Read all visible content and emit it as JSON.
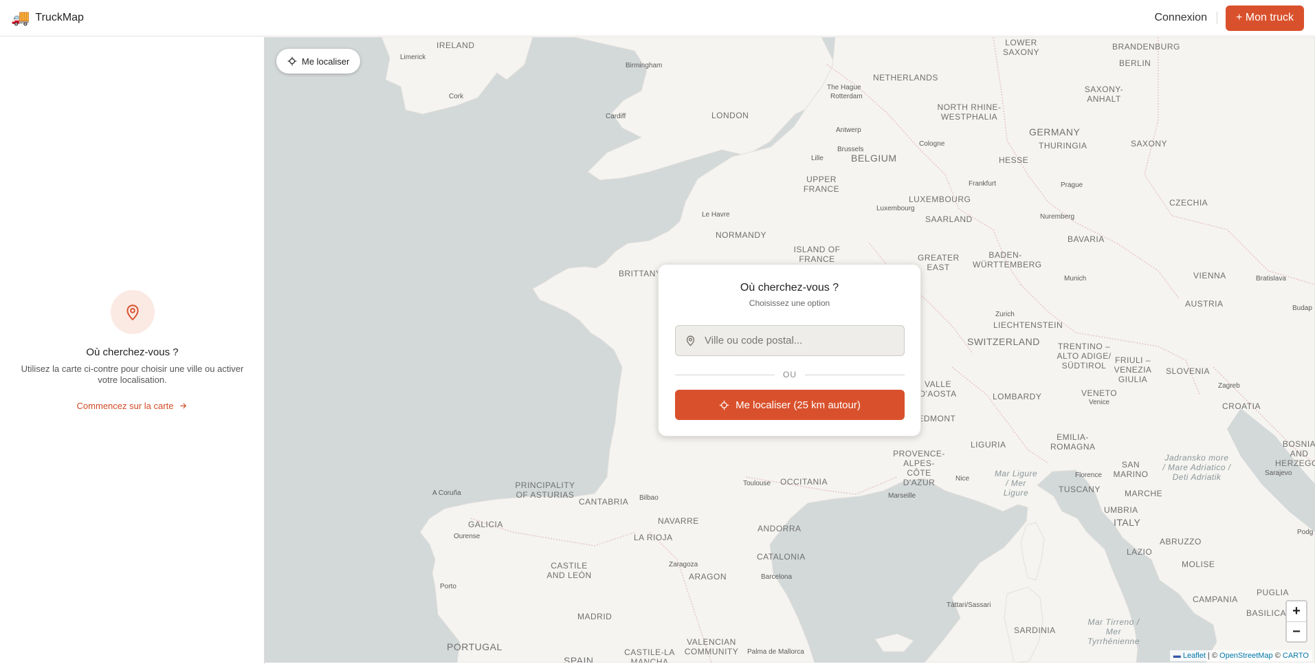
{
  "header": {
    "brand_icon": "🚚",
    "brand_name": "TruckMap",
    "login_label": "Connexion",
    "add_truck_label": "+ Mon truck"
  },
  "sidebar": {
    "empty_title": "Où cherchez-vous ?",
    "empty_text": "Utilisez la carte ci-contre pour choisir une ville ou activer votre localisation.",
    "start_link": "Commencez sur la carte"
  },
  "map": {
    "locate_button": "Me localiser",
    "zoom_in": "+",
    "zoom_out": "−",
    "attribution": {
      "leaflet": "Leaflet",
      "sep1": " | © ",
      "osm": "OpenStreetMap",
      "sep2": " © ",
      "carto": "CARTO"
    },
    "labels": {
      "ireland": "IRELAND",
      "limerick": "Limerick",
      "cork": "Cork",
      "birmingham": "Birmingham",
      "cardiff": "Cardiff",
      "london": "LONDON",
      "lower_saxony": "LOWER SAXONY",
      "brandenburg": "BRANDENBURG",
      "berlin": "BERLIN",
      "netherlands": "NETHERLANDS",
      "the_hague": "The Hague",
      "rotterdam": "Rotterdam",
      "saxony_anhalt": "SAXONY- ANHALT",
      "nrw": "NORTH RHINE- WESTPHALIA",
      "antwerp": "Antwerp",
      "brussels": "Brussels",
      "belgium": "BELGIUM",
      "lille": "Lille",
      "cologne": "Cologne",
      "germany": "GERMANY",
      "thuringia": "THURINGIA",
      "saxony": "SAXONY",
      "hesse": "HESSE",
      "upper_france": "UPPER FRANCE",
      "frankfurt": "Frankfurt",
      "prague": "Prague",
      "czechia": "CZECHIA",
      "luxembourg": "LUXEMBOURG",
      "luxembourg_city": "Luxembourg",
      "le_havre": "Le Havre",
      "nuremberg": "Nuremberg",
      "saarland": "SAARLAND",
      "normandy": "NORMANDY",
      "bavaria": "BAVARIA",
      "island_of_france": "ISLAND OF FRANCE",
      "greater_east": "GREATER EAST",
      "brittany": "BRITTANY",
      "baden": "BADEN- WÜRTTEMBERG",
      "munich": "Munich",
      "vienna": "VIENNA",
      "bratislava": "Bratislava",
      "austria": "AUSTRIA",
      "budapest": "Budap",
      "zurich": "Zurich",
      "liechtenstein": "LIECHTENSTEIN",
      "switzerland": "SWITZERLAND",
      "trentino": "TRENTINO – ALTO ADIGE/ SÜDTIROL",
      "friuli": "FRIULI – VENEZIA GIULIA",
      "slovenia": "SLOVENIA",
      "zagreb": "Zagreb",
      "valle": "VALLE D'AOSTA",
      "lombardy": "LOMBARDY",
      "veneto": "VENETO",
      "venice": "Venice",
      "croatia": "CROATIA",
      "piedmont": "PIEDMONT",
      "liguria": "LIGURIA",
      "emilia": "EMILIA- ROMAGNA",
      "bosnia": "BOSNIA AND HERZEGOVINA",
      "provence": "PROVENCE- ALPES-CÔTE D'AZUR",
      "nice": "Nice",
      "mar_ligure": "Mar Ligure / Mer Ligure",
      "florence": "Florence",
      "san_marino": "SAN MARINO",
      "jadransko": "Jadransko more / Mare Adriatico / Deti Adriatik",
      "sarajevo": "Sarajevo",
      "toulouse": "Toulouse",
      "occitania": "OCCITANIA",
      "marseille": "Marseille",
      "tuscany": "TUSCANY",
      "marche": "MARCHE",
      "a_coruna": "A Coruña",
      "asturias": "PRINCIPALITY OF ASTURIAS",
      "cantabria": "CANTABRIA",
      "bilbao": "Bilbao",
      "galicia": "GALICIA",
      "ourense": "Ourense",
      "navarre": "NAVARRE",
      "andorra": "ANDORRA",
      "umbria": "UMBRIA",
      "italy": "ITALY",
      "abruzzo": "ABRUZZO",
      "podg": "Podg",
      "la_rioja": "LA RIOJA",
      "lazio": "LAZIO",
      "catalonia": "CATALONIA",
      "zaragoza": "Zaragoza",
      "castile_leon": "CASTILE AND LEÓN",
      "aragon": "ARAGON",
      "barcelona": "Barcelona",
      "molise": "MOLISE",
      "porto": "Porto",
      "puglia": "PUGLIA",
      "campania": "CAMPANIA",
      "tattari": "Tàttari/Sassari",
      "basilicata": "BASILICATA",
      "madrid": "MADRID",
      "sardinia": "SARDINIA",
      "mar_tirreno": "Mar Tirreno / Mer Tyrrhénienne",
      "portugal": "PORTUGAL",
      "castile_mancha": "CASTILE-LA MANCHA",
      "valencian": "VALENCIAN COMMUNITY",
      "palma": "Palma de Mallorca",
      "spain": "SPAIN"
    }
  },
  "modal": {
    "title": "Où cherchez-vous ?",
    "subtitle": "Choisissez une option",
    "search_placeholder": "Ville ou code postal...",
    "divider": "OU",
    "geo_button": "Me localiser (25 km autour)"
  },
  "colors": {
    "accent": "#d9512c",
    "land": "#f5f4f1",
    "sea": "#d3d8d9",
    "border": "#e9c6cc"
  },
  "icons": [
    "truck-icon",
    "map-pin-icon",
    "arrow-right-icon",
    "crosshair-icon"
  ]
}
